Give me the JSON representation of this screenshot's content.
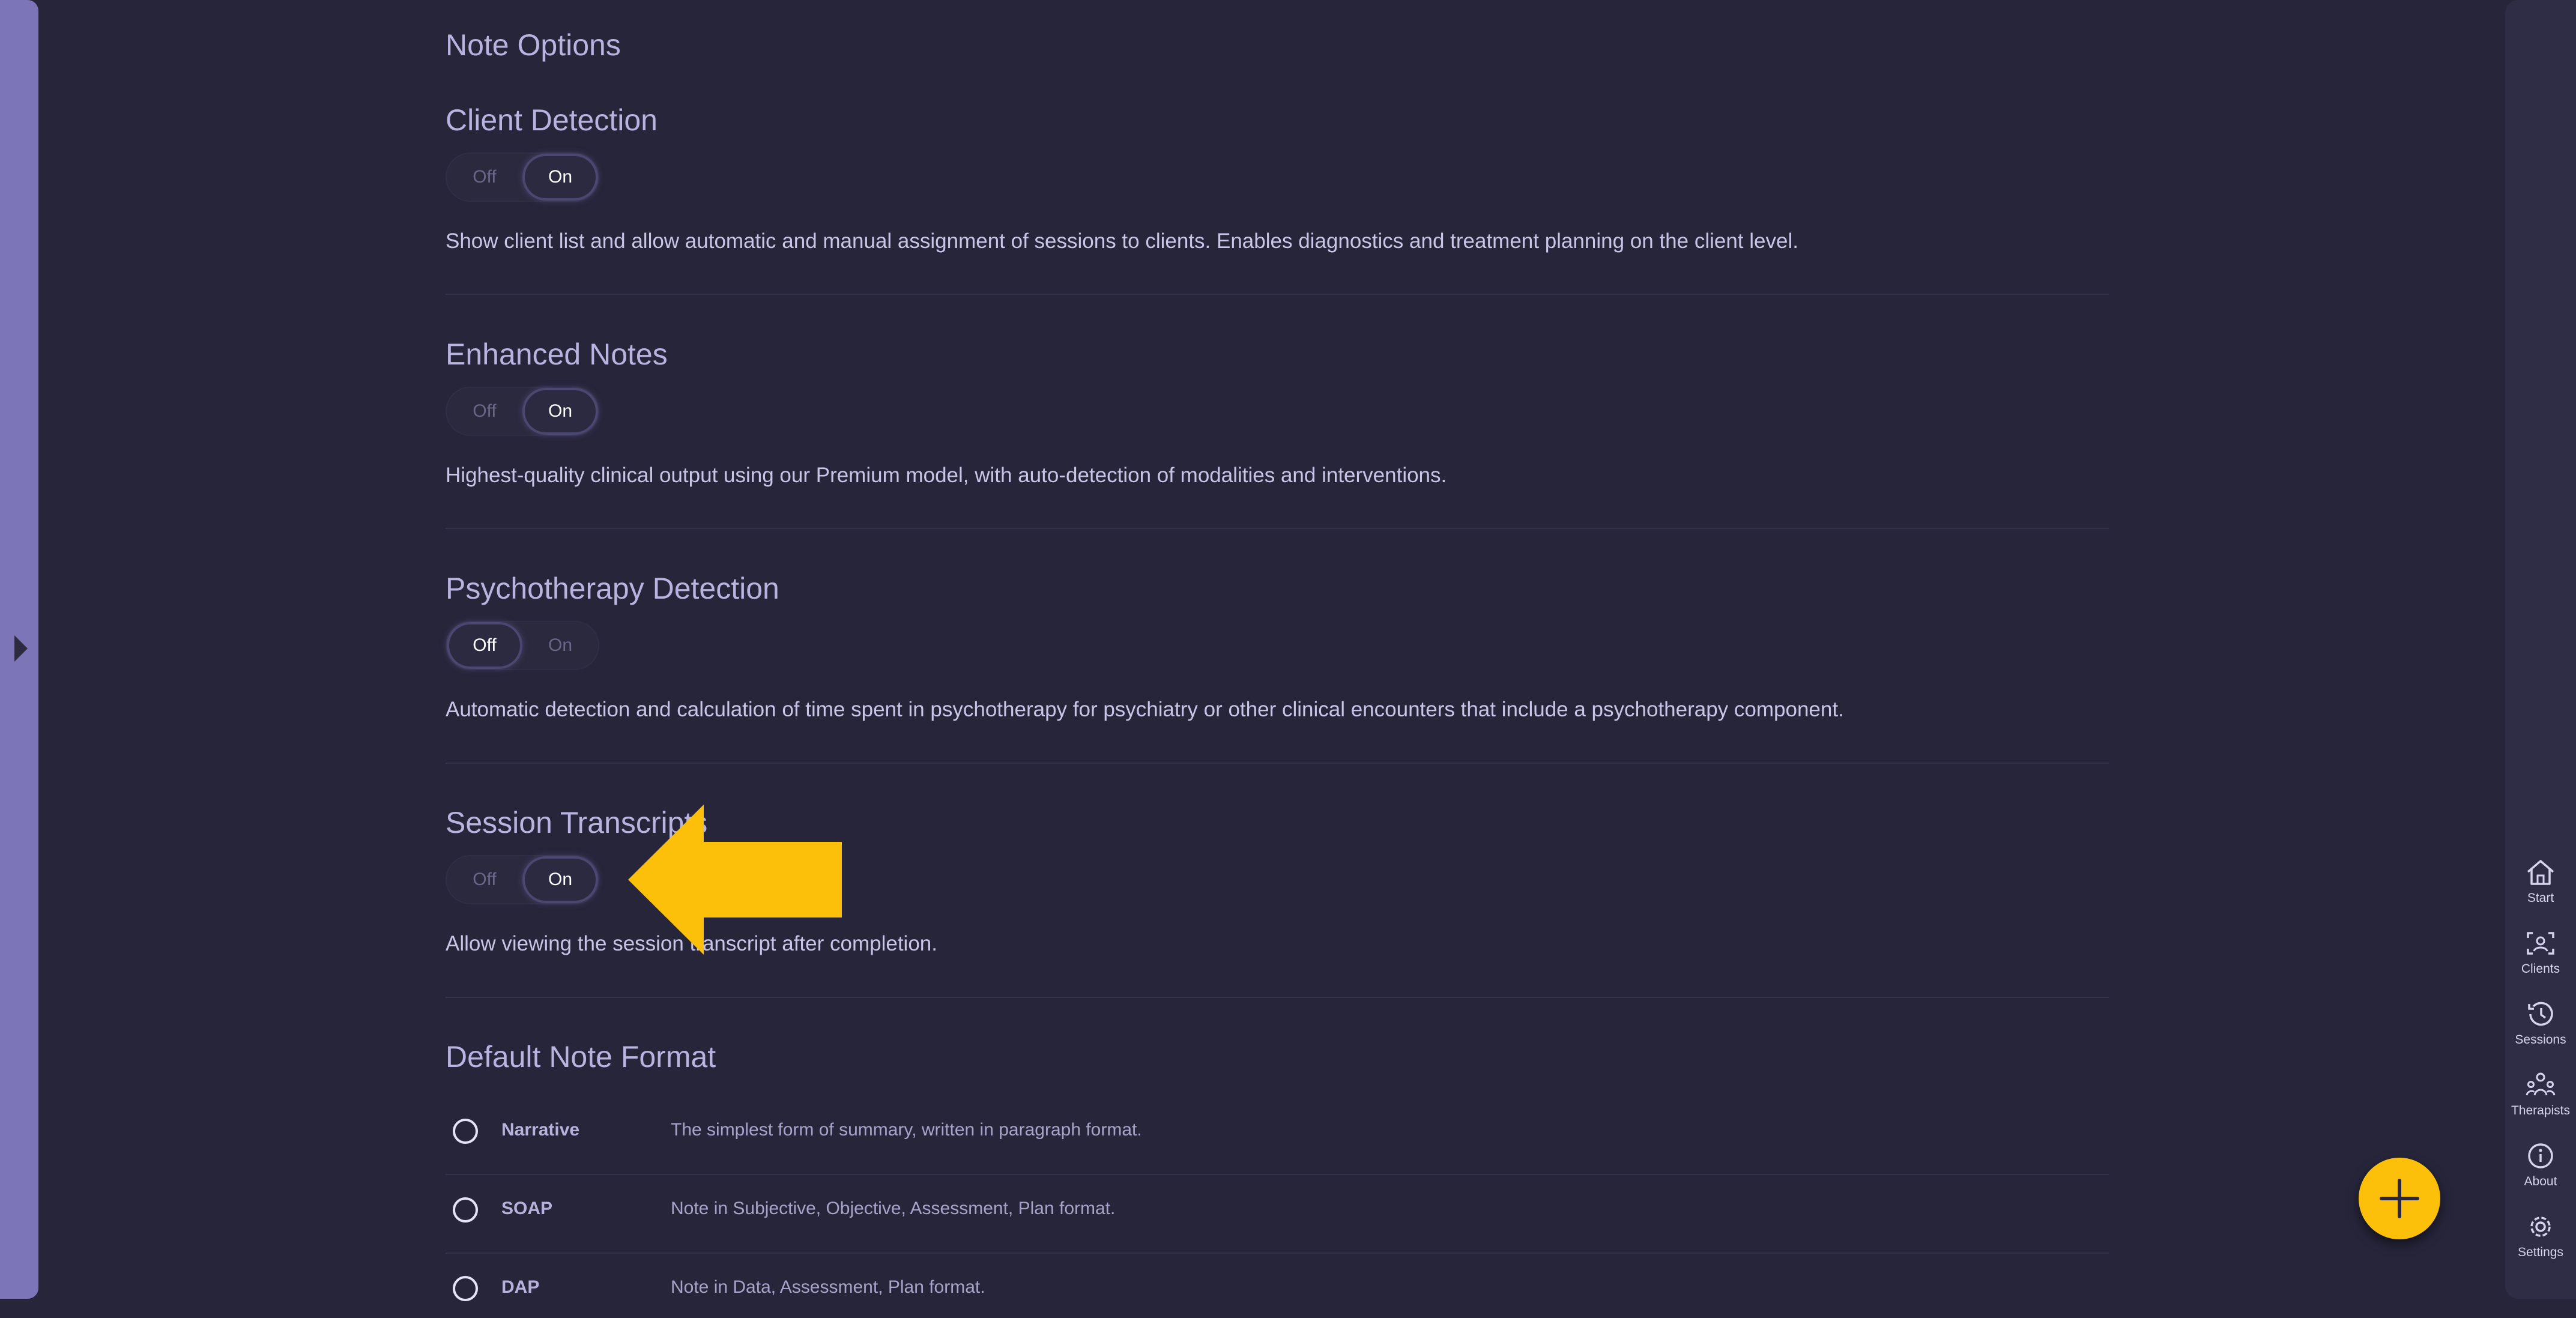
{
  "page": {
    "title": "Note Options"
  },
  "settings": [
    {
      "title": "Client Detection",
      "off_label": "Off",
      "on_label": "On",
      "selected": "On",
      "description": "Show client list and allow automatic and manual assignment of sessions to clients. Enables diagnostics and treatment planning on the client level."
    },
    {
      "title": "Enhanced Notes",
      "off_label": "Off",
      "on_label": "On",
      "selected": "On",
      "description": "Highest-quality clinical output using our Premium model, with auto-detection of modalities and interventions."
    },
    {
      "title": "Psychotherapy Detection",
      "off_label": "Off",
      "on_label": "On",
      "selected": "Off",
      "description": "Automatic detection and calculation of time spent in psychotherapy for psychiatry or other clinical encounters that include a psychotherapy component."
    },
    {
      "title": "Session Transcripts",
      "off_label": "Off",
      "on_label": "On",
      "selected": "On",
      "description": "Allow viewing the session transcript after completion."
    }
  ],
  "default_note_format": {
    "title": "Default Note Format",
    "options": [
      {
        "name": "Narrative",
        "description": "The simplest form of summary, written in paragraph format."
      },
      {
        "name": "SOAP",
        "description": "Note in Subjective, Objective, Assessment, Plan format."
      },
      {
        "name": "DAP",
        "description": "Note in Data, Assessment, Plan format."
      }
    ]
  },
  "nav": {
    "items": [
      {
        "label": "Start",
        "icon": "home-icon"
      },
      {
        "label": "Clients",
        "icon": "clients-icon"
      },
      {
        "label": "Sessions",
        "icon": "history-icon"
      },
      {
        "label": "Therapists",
        "icon": "therapists-icon"
      },
      {
        "label": "About",
        "icon": "info-icon"
      },
      {
        "label": "Settings",
        "icon": "gear-icon"
      }
    ]
  },
  "colors": {
    "background": "#26253a",
    "accent": "#fcbf0a",
    "left_rail": "#7c76b8",
    "right_rail": "#2e2d45"
  },
  "annotations": {
    "highlight_arrow": "arrow-left-icon"
  },
  "fab": {
    "icon": "plus-icon"
  }
}
